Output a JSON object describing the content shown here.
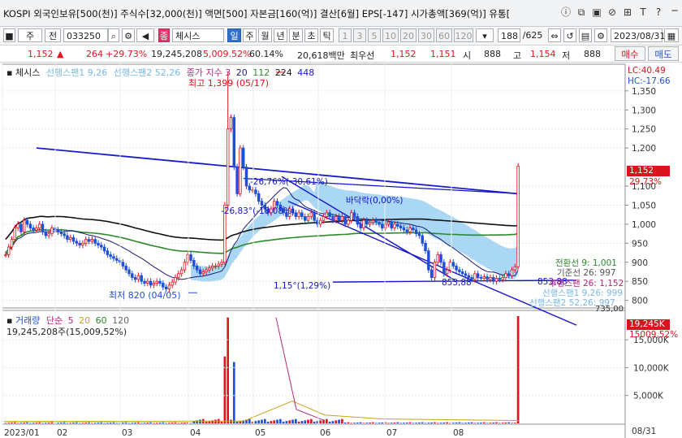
{
  "title_bar": {
    "title": "KOSPI 외국인보유[500(천)] 주식수[32,000(천)] 액면[500] 자본금[160(억)] 결산[6월] EPS[-147] 시가총액[369(억)] 유통[",
    "icons": [
      "info-icon",
      "copy-icon",
      "layout-icon",
      "link-icon",
      "pin-icon",
      "font-size-icon",
      "help-icon",
      "minimize-icon"
    ],
    "glyphs": [
      "ⓘ",
      "⧉",
      "▣",
      "⊘",
      "⊞",
      "T",
      "?",
      "─"
    ]
  },
  "toolbar": {
    "checkbox": "■",
    "market_select": "주",
    "period_btn": "전",
    "code": "033250",
    "search_glyph": "⌕",
    "sound_glyph": "◀",
    "stock_badge": "종",
    "stock_name": "체시스",
    "period_tabs": [
      "일",
      "주",
      "월",
      "년",
      "분",
      "초",
      "틱"
    ],
    "active_tab": "일",
    "intervals": [
      "1",
      "3",
      "5",
      "10",
      "20",
      "30",
      "60",
      "120"
    ],
    "count": "188",
    "total": "/625",
    "date": "2023/08/31",
    "calendar_glyph": "▦"
  },
  "quote": {
    "price": "1,152",
    "arrow": "▲",
    "change": "264",
    "change_pct": "+29.73%",
    "volume": "19,245,208",
    "vol_ratio": "5,009.52%",
    "turnover": "60.14%",
    "amount": "20,618백만",
    "quote_label": "최우선",
    "bid1": "1,152",
    "ask1": "1,151",
    "open_label": "시",
    "open": "888",
    "high_label": "고",
    "high": "1,154",
    "low_label": "저",
    "low": "888",
    "buy_label": "매수",
    "sell_label": "매도"
  },
  "price_panel": {
    "stock_label": "체시스",
    "ichimoku1": "선행스팬1 9,26",
    "ichimoku2": "선행스팬2 52,26",
    "ma_label": "종가 지수 3",
    "ma_20": "20",
    "ma_112": "112",
    "ma_224": "224",
    "ma_448": "448",
    "lc": "LC:40.49",
    "hc": "HC:-17.66",
    "high_annot": "최고 1,399 (05/17)",
    "low_annot": "최저 820 (04/05)",
    "annot1": "-26,76%(-30,61%)",
    "annot2": "-26,83°(-18,08%)",
    "annot3": "바닥락(0,00%)",
    "annot4": "1,15°(1,29%)",
    "annot5": "853,88",
    "annot6": "853,88",
    "ich_conv": "전환선 9: 1,001",
    "ich_base": "기준선 26: 997",
    "ich_lag": "후행스팬 26: 1,152",
    "ich_s1": "선행스팬1 9,26: 999",
    "ich_s2": "선행스팬2 52,26: 997",
    "bottom_val": "735,00",
    "current_price": "1,152",
    "current_pct": "29.73%",
    "yticks": [
      "1,350",
      "1,300",
      "1,250",
      "1,200",
      "1,100",
      "1,050",
      "1,000",
      "950",
      "900",
      "850",
      "800"
    ]
  },
  "volume_panel": {
    "label": "거래량",
    "ma_label": "단순",
    "ma_5": "5",
    "ma_20": "20",
    "ma_60": "60",
    "ma_120": "120",
    "vol_text": "19,245,208주(15,009,52%)",
    "current_vol": "19,245K",
    "current_pct": "15009,52%",
    "yticks": [
      "15,000K",
      "10,000K",
      "5,000K"
    ],
    "last_date": "08/31"
  },
  "x_axis": {
    "labels": [
      "2023/01",
      "02",
      "03",
      "04",
      "05",
      "06",
      "07",
      "08"
    ]
  },
  "colors": {
    "up": "#e0141e",
    "down": "#1f4fd8",
    "cloud": "#8ec9ef",
    "ma20": "#1a1a7a",
    "ma112": "#2a8a2a",
    "ma224": "#111111",
    "ma448": "#1a1acc",
    "trend": "#1414c8",
    "accent": "#2f6fce"
  },
  "chart_data": {
    "type": "candlestick",
    "ylim": [
      800,
      1400
    ],
    "x_range": [
      "2023/01",
      "2023/08/31"
    ],
    "high": {
      "value": 1399,
      "date": "05/17"
    },
    "low": {
      "value": 820,
      "date": "04/05"
    },
    "last": {
      "close": 1152,
      "open": 888,
      "high": 1154,
      "low": 888,
      "change_pct": 29.73
    },
    "closes": [
      920,
      940,
      960,
      990,
      1000,
      980,
      1010,
      1000,
      990,
      985,
      990,
      1000,
      980,
      970,
      975,
      990,
      985,
      980,
      975,
      970,
      960,
      965,
      955,
      950,
      945,
      950,
      960,
      955,
      960,
      950,
      945,
      940,
      930,
      920,
      915,
      910,
      905,
      900,
      890,
      880,
      870,
      860,
      855,
      865,
      850,
      845,
      850,
      840,
      845,
      850,
      845,
      835,
      830,
      840,
      848,
      860,
      870,
      880,
      900,
      920,
      905,
      890,
      880,
      870,
      875,
      880,
      885,
      890,
      890,
      895,
      900,
      1050,
      1250,
      1280,
      1150,
      1080,
      1200,
      1150,
      1100,
      1090,
      1090,
      1080,
      1060,
      1050,
      1040,
      1030,
      1040,
      1060,
      1050,
      1040,
      1030,
      1020,
      1040,
      1030,
      1020,
      1030,
      1020,
      1010,
      1020,
      1030,
      1010,
      1000,
      1010,
      1020,
      1030,
      1020,
      1010,
      1020,
      1010,
      1020,
      1000,
      1010,
      1030,
      1020,
      1000,
      990,
      1010,
      1000,
      1005,
      1010,
      1005,
      1000,
      990,
      1000,
      1005,
      990,
      1000,
      995,
      990,
      985,
      980,
      990,
      985,
      975,
      970,
      950,
      930,
      880,
      860,
      900,
      920,
      900,
      870,
      880,
      900,
      890,
      880,
      875,
      870,
      865,
      860,
      855,
      870,
      860,
      858,
      862,
      855,
      860,
      850,
      858,
      855,
      860,
      870,
      865,
      880,
      888,
      1152
    ],
    "volume_unit": "K",
    "volume_ylim": [
      0,
      19245
    ],
    "volume_spikes": [
      {
        "date": "05/15",
        "value": 12000
      },
      {
        "date": "05/17",
        "value": 19000
      },
      {
        "date": "05/19",
        "value": 11000
      },
      {
        "date": "08/31",
        "value": 19245
      }
    ]
  }
}
